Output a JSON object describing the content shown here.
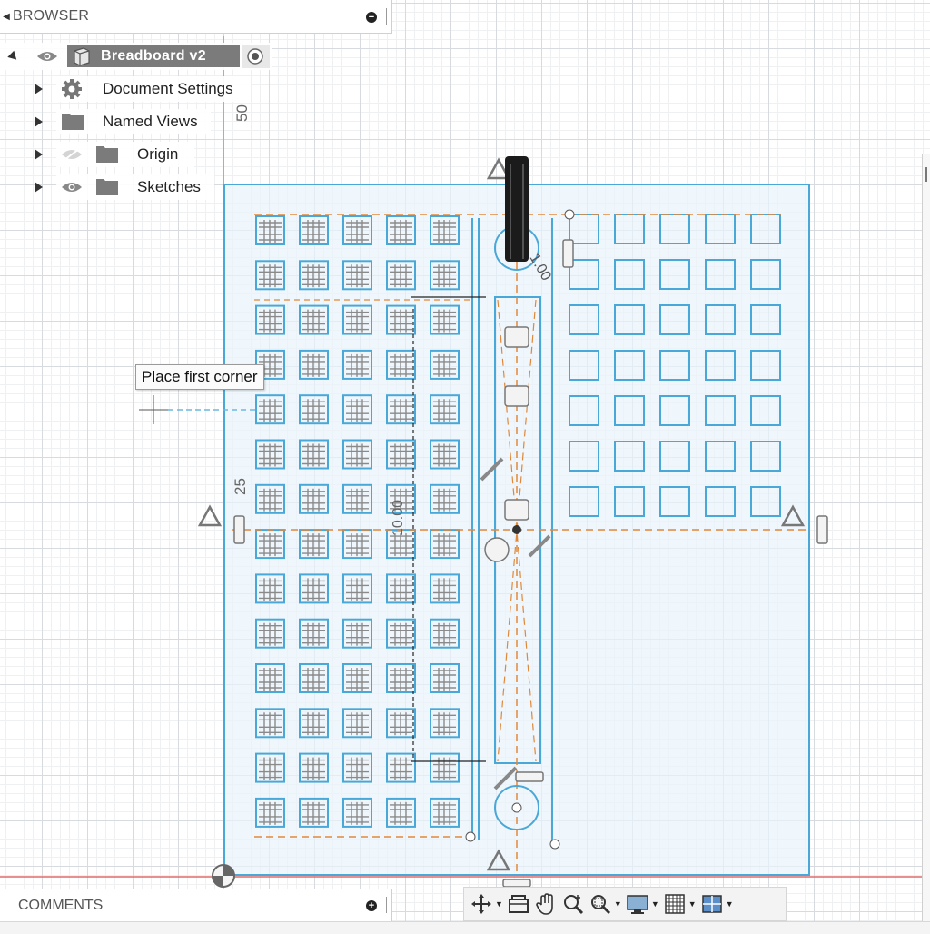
{
  "browser": {
    "title": "BROWSER",
    "root": {
      "label": "Breadboard v2"
    },
    "items": [
      {
        "label": "Document Settings",
        "icon": "gear-icon"
      },
      {
        "label": "Named Views",
        "icon": "folder-icon"
      },
      {
        "label": "Origin",
        "icon": "folder-icon",
        "hidden": true
      },
      {
        "label": "Sketches",
        "icon": "folder-icon"
      }
    ]
  },
  "tooltip": {
    "text": "Place first corner"
  },
  "dimensions": {
    "top_value": "50",
    "side_value": "25",
    "angle_value": "1.00",
    "vertical_value": "10.00"
  },
  "comments": {
    "title": "COMMENTS"
  },
  "colors": {
    "sketch_blue": "#4aa8d8",
    "construction_orange": "#e0883a",
    "sketch_fill": "#e8f3fa",
    "axis_red": "#e06b6b",
    "axis_green": "#7fcf7f"
  },
  "toolbar": {
    "items": [
      {
        "icon": "orbit-icon",
        "dropdown": true
      },
      {
        "icon": "capture-position-icon",
        "dropdown": false
      },
      {
        "icon": "pan-icon",
        "dropdown": false
      },
      {
        "icon": "zoom-icon",
        "dropdown": false
      },
      {
        "icon": "fit-icon",
        "dropdown": true
      },
      {
        "icon": "display-settings-icon",
        "dropdown": true
      },
      {
        "icon": "grid-settings-icon",
        "dropdown": true
      },
      {
        "icon": "viewports-icon",
        "dropdown": true
      }
    ]
  }
}
